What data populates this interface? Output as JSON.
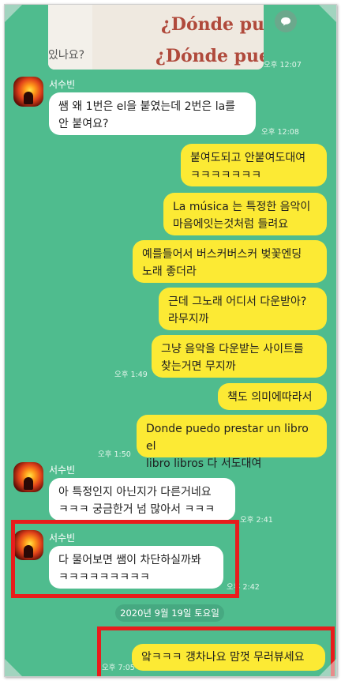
{
  "top_image": {
    "caption_line1": "¿Dónde pued",
    "caption_line2": "¿Dónde pued",
    "left_text": "있나요?",
    "time": "오후 12:07"
  },
  "messages": {
    "m1": {
      "sender": "서수빈",
      "text_line1": "쌤 왜 1번은 el을 붙였는데 2번은 la를",
      "text_line2": "안 붙여요?",
      "time": "오후 12:08"
    },
    "m2": {
      "text_line1": "붙여도되고 안붙여도대여",
      "text_line2": "ㅋㅋㅋㅋㅋㅋㅋ"
    },
    "m3": {
      "text_line1": "La música 는 특정한 음악이",
      "text_line2": "마음에잇는것처럼 들려요"
    },
    "m4": {
      "text_line1": "예를들어서 버스커버스커 벚꽃엔딩",
      "text_line2": "노래 좋더라"
    },
    "m5": {
      "text_line1": "근데 그노래 어디서 다운받아?",
      "text_line2": "라무지까"
    },
    "m6": {
      "text_line1": "그냥 음악을 다운받는 사이트를",
      "text_line2": "찾는거면 무지까",
      "time": "오후 1:49"
    },
    "m7": {
      "text_line1": "책도 의미에따라서"
    },
    "m8": {
      "text_line1": "Donde puedo prestar un libro el",
      "text_line2": "libro libros 다 서도대여",
      "time": "오후 1:50"
    },
    "m9": {
      "sender": "서수빈",
      "text_line1": "아 특정인지 아닌지가 다른거네요",
      "text_line2": "ㅋㅋㅋ 궁금한거 넘 많아서 ㅋㅋㅋ",
      "time": "오후 2:41"
    },
    "m10": {
      "sender": "서수빈",
      "text_line1": "다 물어보면 쌤이 차단하실까봐",
      "text_line2": "ㅋㅋㅋㅋㅋㅋㅋㅋㅋ",
      "time": "오후 2:42"
    },
    "m11": {
      "text_line1": "앜ㅋㅋㅋ 갱차나요 맘껏 무러뷰세요",
      "time": "오후 7:05"
    }
  },
  "date_divider": "2020년 9월 19일 토요일",
  "colors": {
    "background": "#4fbc8e",
    "my_bubble": "#fcea34",
    "their_bubble": "#ffffff",
    "highlight_box": "#e81c1c"
  },
  "icons": [
    "chat-bubble-icon",
    "avatar-sunset"
  ]
}
